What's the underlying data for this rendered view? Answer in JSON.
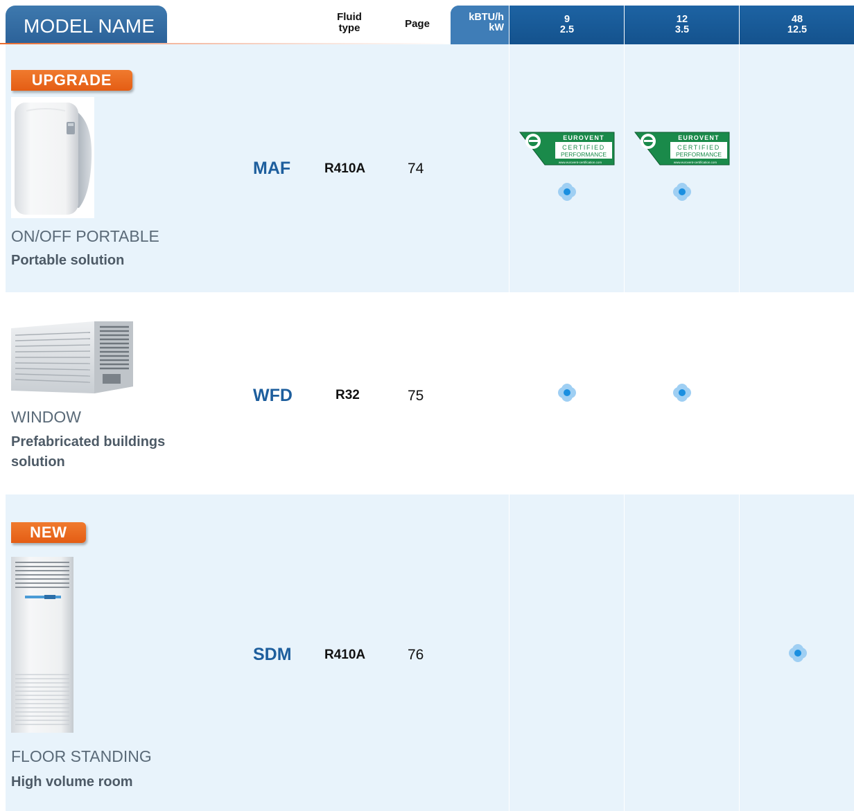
{
  "header": {
    "model_name": "MODEL NAME",
    "fluid_type_line1": "Fluid",
    "fluid_type_line2": "type",
    "page": "Page",
    "unit_line1": "kBTU/h",
    "unit_line2": "kW",
    "capacities": [
      {
        "kbtu": "9",
        "kw": "2.5"
      },
      {
        "kbtu": "12",
        "kw": "3.5"
      },
      {
        "kbtu": "48",
        "kw": "12.5"
      }
    ]
  },
  "rows": [
    {
      "badge": "UPGRADE",
      "model": "MAF",
      "fluid": "R410A",
      "page": "74",
      "type": "ON/OFF PORTABLE",
      "subtitle": "Portable solution",
      "eurovent_capacities": [
        "9",
        "12"
      ],
      "available_capacities": [
        "9",
        "12"
      ]
    },
    {
      "badge": "",
      "model": "WFD",
      "fluid": "R32",
      "page": "75",
      "type": "WINDOW",
      "subtitle_line1": "Prefabricated buildings",
      "subtitle_line2": "solution",
      "available_capacities": [
        "9",
        "12"
      ]
    },
    {
      "badge": "NEW",
      "model": "SDM",
      "fluid": "R410A",
      "page": "76",
      "type": "FLOOR STANDING",
      "subtitle": "High volume room",
      "available_capacities": [
        "48"
      ]
    }
  ],
  "eurovent": {
    "line1": "EUROVENT",
    "line2": "CERTIFIED",
    "line3": "PERFORMANCE",
    "url": "www.eurovent-certification.com"
  },
  "colors": {
    "header_blue": "#14528d",
    "unit_cell_blue": "#3f7db7",
    "model_tab_blue": "#2c6299",
    "badge_orange": "#e45d14",
    "row_background": "#e8f3fb",
    "model_code_blue": "#1d5e9d",
    "dot_blue": "#1a8fe0",
    "eurovent_green": "#1a8a4a"
  },
  "icons": {
    "availability": "availability-dot-icon",
    "certification": "eurovent-certified-logo"
  }
}
